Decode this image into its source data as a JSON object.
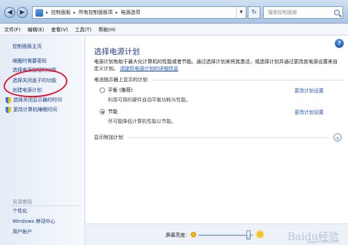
{
  "address_bar": {
    "path": [
      "控制面板",
      "所有控制面板项",
      "电源选项"
    ],
    "search_placeholder": "搜索控制面板"
  },
  "menu": [
    "文件(F)",
    "编辑(E)",
    "查看(V)",
    "工具(T)",
    "帮助(H)"
  ],
  "sidebar": {
    "home": "控制面板主页",
    "links": [
      "唤醒时需要密码",
      "选择电源按钮的功能",
      "选择关闭盖子的功能",
      "创建电源计划",
      "选择关闭显示器的时间",
      "更改计算机睡眠时间"
    ],
    "see_also_title": "另请参阅",
    "see_also": [
      "个性化",
      "Windows 移动中心",
      "用户帐户"
    ]
  },
  "main": {
    "title": "选择电源计划",
    "description": "电源计划有助于最大化计算机的性能或者节能。通过选择计划来将其激活，或选择计划并通过更改其电源设置来自定义计划。",
    "description_link": "请提供电源计划的详细信息",
    "section_header": "电池指示器上显示的计划",
    "plans": [
      {
        "name": "平衡 (推荐)",
        "desc": "利用可用的硬件自动平衡功耗与性能。",
        "selected": false,
        "change_link": "更改计划设置"
      },
      {
        "name": "节能",
        "desc": "尽可能降低计算机性能以节能。",
        "selected": true,
        "change_link": "更改计划设置"
      }
    ],
    "more_plans": "显示附加计划"
  },
  "bottom": {
    "brightness_label": "屏幕亮度:",
    "brightness_level": 0.92
  },
  "watermark": {
    "text": "Baidu经验",
    "sub": "jingyan.baidu.com"
  },
  "colors": {
    "link": "#1c3c8a",
    "title": "#1e3f8f",
    "annotation": "#e3122a"
  }
}
